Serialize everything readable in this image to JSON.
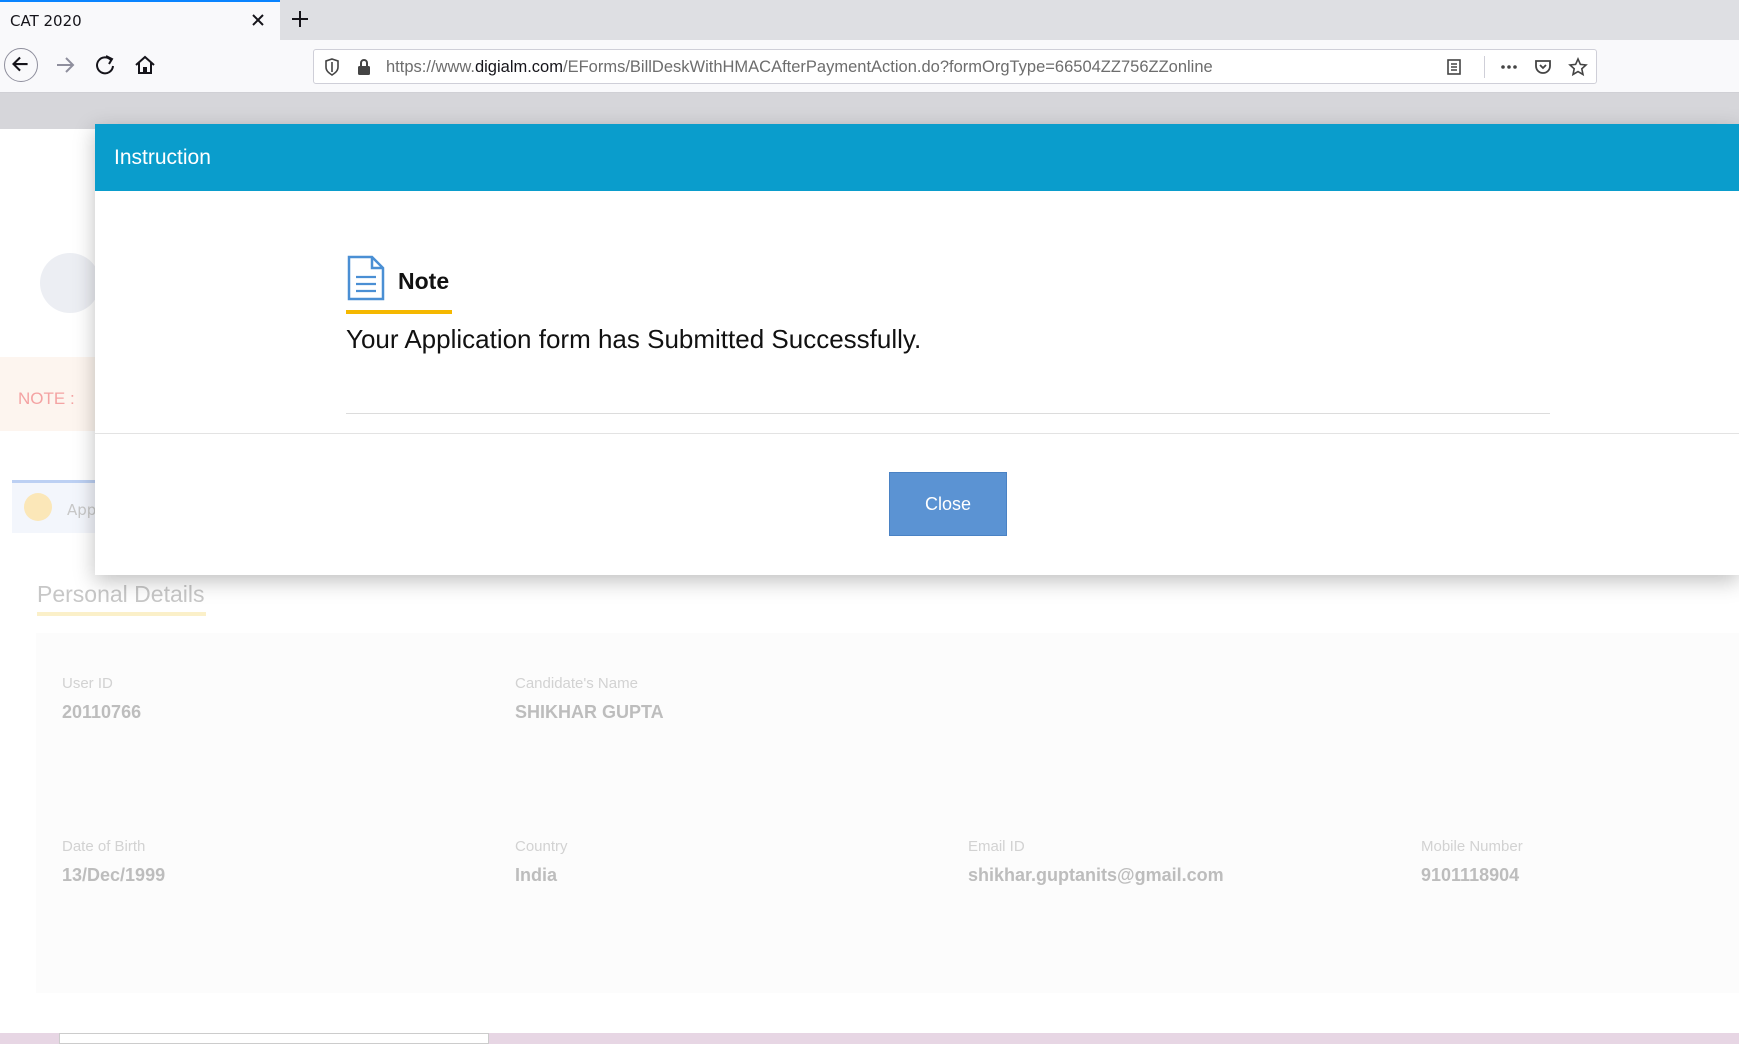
{
  "browser": {
    "tab_title": "CAT 2020",
    "url_prefix": "https://www.",
    "url_host": "digialm.com",
    "url_path": "/EForms/BillDeskWithHMACAfterPaymentAction.do?formOrgType=66504ZZ756ZZonline"
  },
  "page": {
    "note_label": "NOTE :",
    "application_tab_label": "App",
    "section_title": "Personal Details",
    "fields": [
      {
        "label": "User ID",
        "value": "20110766"
      },
      {
        "label": "Candidate's Name",
        "value": "SHIKHAR GUPTA"
      },
      {
        "label": "Date of Birth",
        "value": "13/Dec/1999"
      },
      {
        "label": "Country",
        "value": "India"
      },
      {
        "label": "Email ID",
        "value": "shikhar.guptanits@gmail.com"
      },
      {
        "label": "Mobile Number",
        "value": "9101118904"
      }
    ]
  },
  "modal": {
    "title": "Instruction",
    "note_heading": "Note",
    "message": "Your Application form has Submitted Successfully.",
    "close_label": "Close",
    "header_color": "#0a9dcc",
    "accent_color": "#f5b800",
    "button_color": "#5b93d3"
  },
  "icons": [
    "close-icon",
    "plus-icon",
    "back-arrow-icon",
    "forward-arrow-icon",
    "reload-icon",
    "home-icon",
    "shield-icon",
    "lock-icon",
    "reader-view-icon",
    "more-icon",
    "pocket-icon",
    "star-icon",
    "document-icon"
  ]
}
